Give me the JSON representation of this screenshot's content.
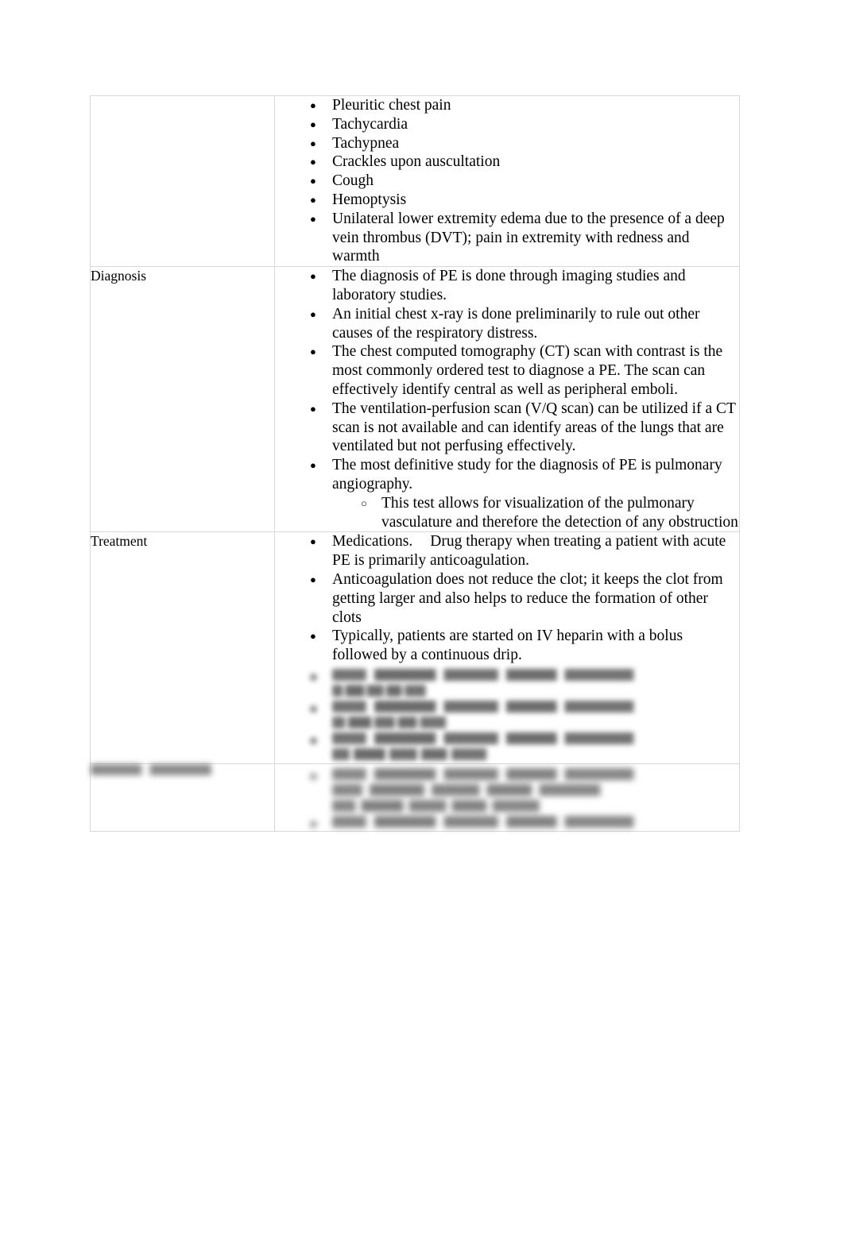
{
  "document": {
    "type": "study-notes-table",
    "topic_abbreviation": "PE",
    "rows": [
      {
        "id": "signs-symptoms",
        "label": "",
        "label_visible": false,
        "legible": true,
        "bullets": [
          {
            "text": "Pleuritic chest pain",
            "level": 1
          },
          {
            "text": "Tachycardia",
            "level": 1
          },
          {
            "text": "Tachypnea",
            "level": 1
          },
          {
            "text": "Crackles upon auscultation",
            "level": 1
          },
          {
            "text": "Cough",
            "level": 1
          },
          {
            "text": "Hemoptysis",
            "level": 1
          },
          {
            "text": "Unilateral lower extremity edema due to the presence of a deep vein thrombus (DVT); pain in extremity with redness and warmth",
            "level": 1
          }
        ]
      },
      {
        "id": "diagnosis",
        "label": "Diagnosis",
        "label_visible": true,
        "legible": true,
        "bullets": [
          {
            "text": "The diagnosis of PE is done through imaging studies and laboratory studies.",
            "level": 1
          },
          {
            "text": "An initial chest x-ray is done preliminarily to rule out other causes of the respiratory distress.",
            "level": 1
          },
          {
            "text": "The chest computed tomography (CT) scan with contrast is the most commonly ordered test to diagnose a PE. The scan can effectively identify central as well as peripheral emboli.",
            "level": 1
          },
          {
            "text": "The ventilation-perfusion scan (V/Q scan) can be utilized if a CT scan is not available and can identify areas of the lungs that are ventilated but not perfusing effectively.",
            "level": 1
          },
          {
            "text": "The most definitive study for the diagnosis of PE is pulmonary angiography.",
            "level": 1
          },
          {
            "text": "This test allows for visualization of the pulmonary vasculature and therefore the detection of any obstruction",
            "level": 2
          }
        ]
      },
      {
        "id": "treatment",
        "label": "Treatment",
        "label_visible": true,
        "legible": true,
        "bullets": [
          {
            "text_before_gap": "Medications.",
            "text_after_gap": "Drug therapy when treating a patient with acute PE is primarily anticoagulation.",
            "level": 1,
            "has_wide_gap": true
          },
          {
            "text": "Anticoagulation does not reduce the clot; it keeps the clot from getting larger and also helps to reduce the formation of other clots",
            "level": 1
          },
          {
            "text": "Typically, patients are started on IV heparin with a bolus followed by a continuous drip.",
            "level": 1
          }
        ],
        "redacted_bullets": [
          {
            "lines": [
              "w90",
              "w28"
            ]
          },
          {
            "lines": [
              "w90",
              "w34"
            ]
          },
          {
            "lines": [
              "w90",
              "w46"
            ]
          }
        ]
      },
      {
        "id": "last-row",
        "label": "",
        "label_visible": false,
        "label_redacted": true,
        "legible": false,
        "redacted_bullets": [
          {
            "lines": [
              "w90",
              "w80",
              "w62"
            ]
          },
          {
            "lines": [
              "w90"
            ]
          }
        ]
      }
    ]
  },
  "notes": {
    "illegible_marker": "Portions of this page are blurred and unreadable in the source screenshot."
  }
}
